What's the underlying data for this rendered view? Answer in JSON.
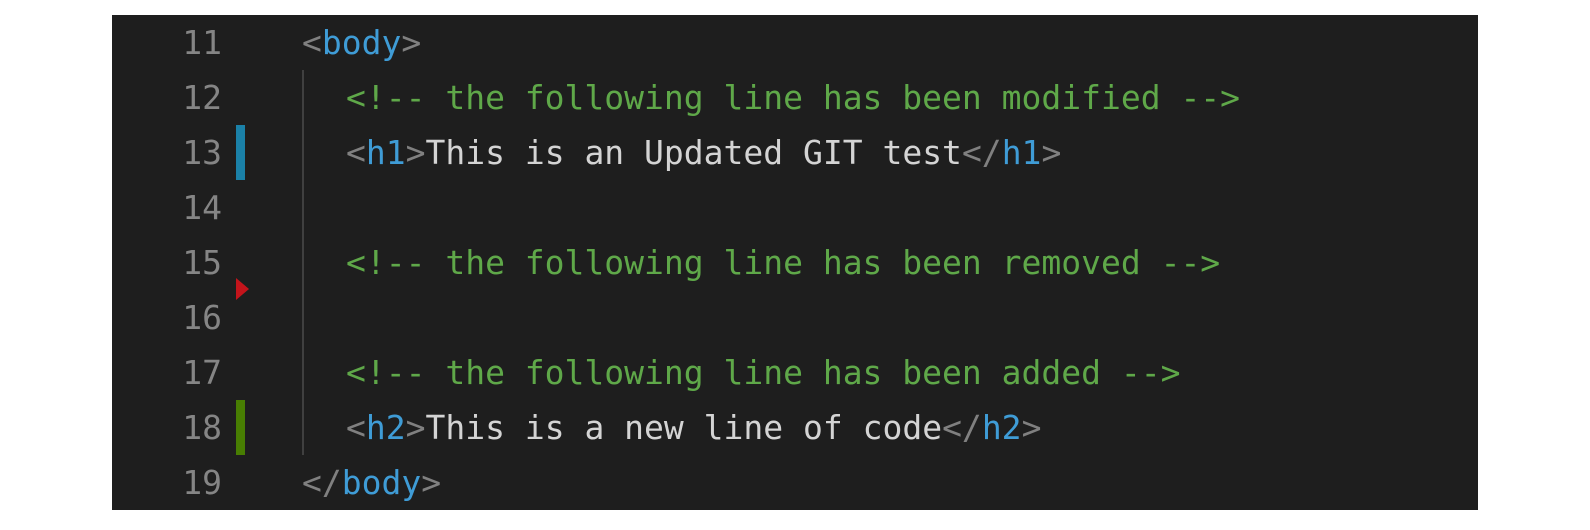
{
  "colors": {
    "background": "#1e1e1e",
    "line_number": "#858585",
    "tag": "#3f9cd6",
    "bracket": "#808080",
    "text": "#d4d4d4",
    "comment": "#5fa849",
    "modified_marker": "#1b81a8",
    "added_marker": "#487e02",
    "deleted_marker": "#c4141b"
  },
  "lines": [
    {
      "number": "11",
      "open": "<",
      "tag": "body",
      "close": ">"
    },
    {
      "number": "12",
      "comment": "<!-- the following line has been modified -->"
    },
    {
      "number": "13",
      "marker": "modified",
      "open": "<",
      "tag": "h1",
      "close": ">",
      "text": "This is an Updated GIT test",
      "end_open": "</",
      "end_tag": "h1",
      "end_close": ">"
    },
    {
      "number": "14"
    },
    {
      "number": "15",
      "comment": "<!-- the following line has been removed -->",
      "marker_after": "deleted"
    },
    {
      "number": "16"
    },
    {
      "number": "17",
      "comment": "<!-- the following line has been added -->"
    },
    {
      "number": "18",
      "marker": "added",
      "open": "<",
      "tag": "h2",
      "close": ">",
      "text": "This is a new line of code",
      "end_open": "</",
      "end_tag": "h2",
      "end_close": ">"
    },
    {
      "number": "19",
      "open": "</",
      "tag": "body",
      "close": ">"
    }
  ]
}
